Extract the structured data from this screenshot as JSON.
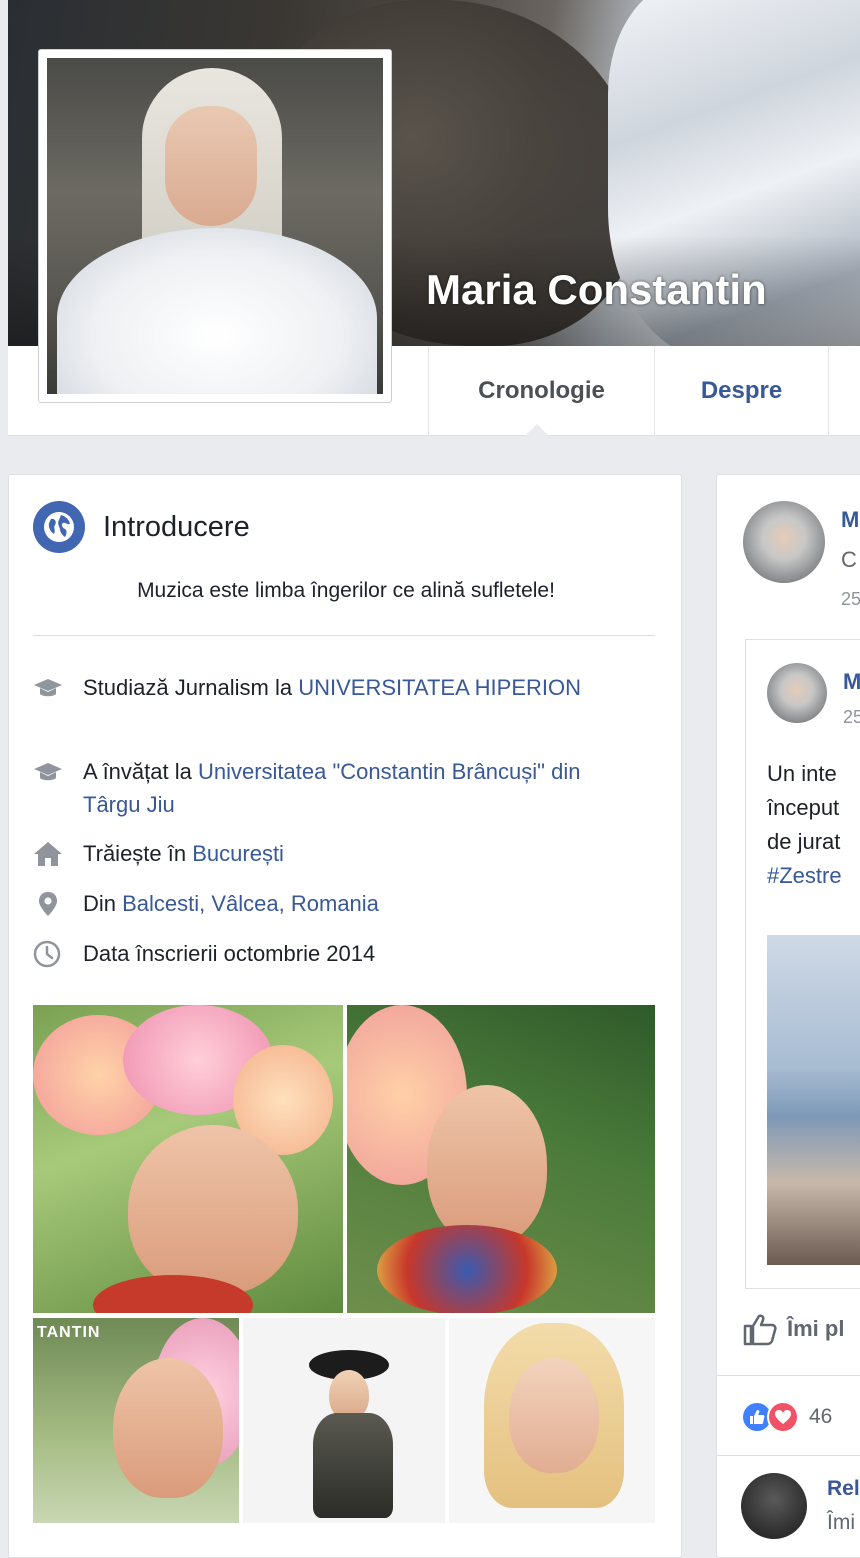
{
  "profile": {
    "name": "Maria Constantin"
  },
  "nav": {
    "tabs": [
      {
        "label": "Cronologie",
        "active": true
      },
      {
        "label": "Despre",
        "active": false
      }
    ]
  },
  "intro": {
    "title": "Introducere",
    "bio": "Muzica este limba îngerilor ce alină sufletele!",
    "rows": [
      {
        "icon": "graduation-cap-icon",
        "text": "Studiază Jurnalism la ",
        "link": "UNIVERSITATEA HIPERION"
      },
      {
        "icon": "graduation-cap-icon",
        "text": "A învățat la ",
        "link": "Universitatea \"Constantin Brâncuși\" din Târgu Jiu"
      },
      {
        "icon": "home-icon",
        "text": "Trăiește în ",
        "link": "București"
      },
      {
        "icon": "location-pin-icon",
        "text": "Din ",
        "link": "Balcesti, Vâlcea, Romania"
      },
      {
        "icon": "clock-icon",
        "text": "Data înscrierii octombrie 2014",
        "link": ""
      }
    ],
    "photo_watermark": "TANTIN"
  },
  "feed": {
    "author_initial": "M",
    "author_sub": "C",
    "date_fragment": "25",
    "shared_author_initial": "M",
    "shared_date_fragment": "25",
    "post_lines": [
      "Un inte",
      "început",
      "de jurat"
    ],
    "hashtag": "#Zestre",
    "like_label": "Îmi pl",
    "reaction_count": "46",
    "comment_name": "Rel",
    "comment_sub": "Îmi"
  },
  "colors": {
    "link": "#385898",
    "brand": "#4267b2",
    "background": "#e9ebee"
  }
}
